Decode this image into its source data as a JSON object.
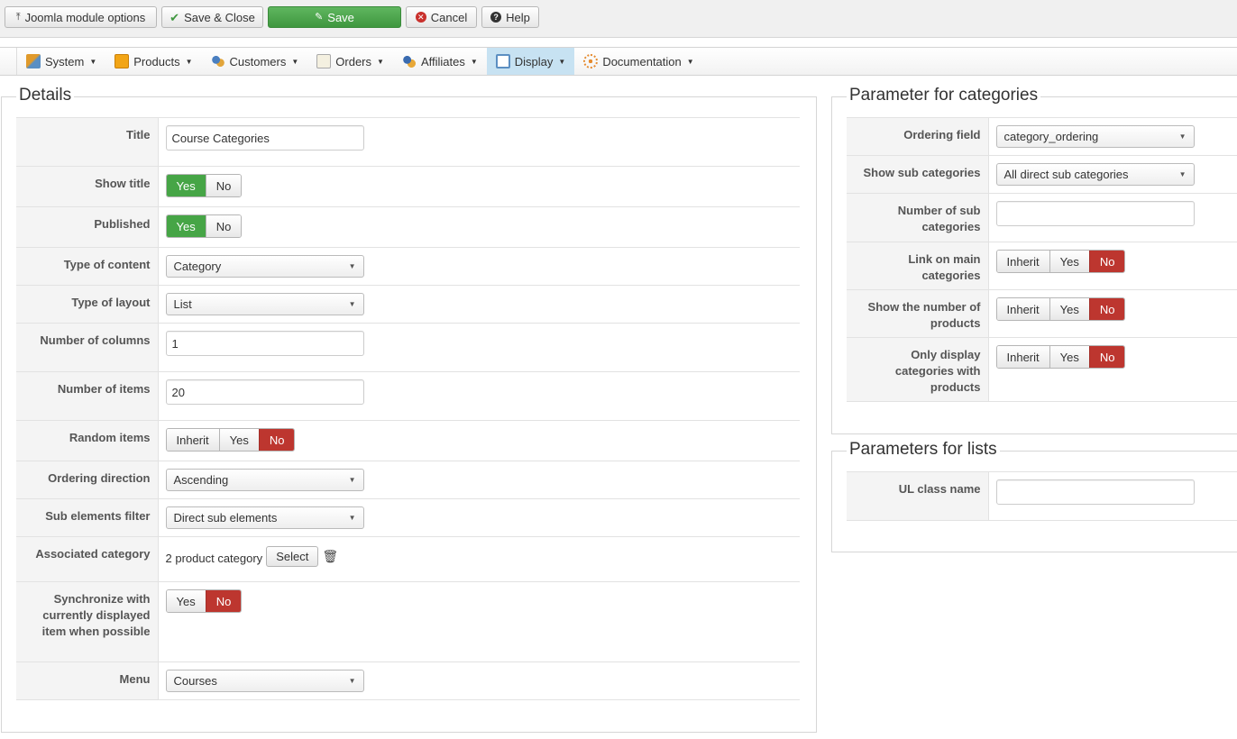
{
  "toolbar": {
    "options_label": "Joomla module options",
    "save_close_label": "Save & Close",
    "save_label": "Save",
    "cancel_label": "Cancel",
    "help_label": "Help"
  },
  "menu": {
    "items": [
      {
        "label": "System",
        "icon": "wrench-icon"
      },
      {
        "label": "Products",
        "icon": "products-icon"
      },
      {
        "label": "Customers",
        "icon": "customers-icon"
      },
      {
        "label": "Orders",
        "icon": "orders-icon"
      },
      {
        "label": "Affiliates",
        "icon": "affiliates-icon"
      },
      {
        "label": "Display",
        "icon": "display-icon",
        "active": true
      },
      {
        "label": "Documentation",
        "icon": "documentation-icon"
      }
    ]
  },
  "details": {
    "legend": "Details",
    "title_label": "Title",
    "title_value": "Course Categories",
    "show_title_label": "Show title",
    "published_label": "Published",
    "yes": "Yes",
    "no": "No",
    "inherit": "Inherit",
    "type_content_label": "Type of content",
    "type_content_value": "Category",
    "type_layout_label": "Type of layout",
    "type_layout_value": "List",
    "columns_label": "Number of columns",
    "columns_value": "1",
    "items_label": "Number of items",
    "items_value": "20",
    "random_label": "Random items",
    "ordering_dir_label": "Ordering direction",
    "ordering_dir_value": "Ascending",
    "sub_filter_label": "Sub elements filter",
    "sub_filter_value": "Direct sub elements",
    "assoc_label": "Associated category",
    "assoc_value": "2 product category",
    "select_label": "Select",
    "sync_label": "Synchronize with currently displayed item when possible",
    "menu_label": "Menu",
    "menu_value": "Courses"
  },
  "categories": {
    "legend": "Parameter for categories",
    "ordering_field_label": "Ordering field",
    "ordering_field_value": "category_ordering",
    "show_sub_label": "Show sub categories",
    "show_sub_value": "All direct sub categories",
    "num_sub_label": "Number of sub categories",
    "num_sub_value": "",
    "link_main_label": "Link on main categories",
    "show_number_label": "Show the number of products",
    "only_display_label": "Only display categories with products"
  },
  "lists": {
    "legend": "Parameters for lists",
    "ul_class_label": "UL class name",
    "ul_class_value": ""
  },
  "colors": {
    "green": "#46a546",
    "red": "#bd362f",
    "active_menu": "#c7e2f2"
  }
}
